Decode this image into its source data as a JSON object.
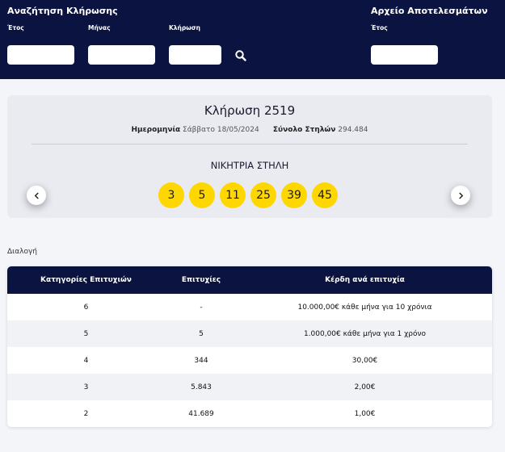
{
  "search": {
    "heading": "Αναζήτηση Κλήρωσης",
    "year_label": "Έτος",
    "month_label": "Μήνας",
    "draw_label": "Κλήρωση"
  },
  "archive": {
    "heading": "Αρχείο Αποτελεσμάτων",
    "year_label": "Έτος"
  },
  "draw": {
    "title": "Κλήρωση 2519",
    "date_label": "Ημερομηνία",
    "date_value": "Σάββατο 18/05/2024",
    "columns_label": "Σύνολο Στηλών",
    "columns_value": "294.484",
    "winning_label": "ΝΙΚΗΤΡΙΑ ΣΤΗΛΗ",
    "numbers": [
      "3",
      "5",
      "11",
      "25",
      "39",
      "45"
    ]
  },
  "section_label": "Διαλογή",
  "table": {
    "headers": [
      "Κατηγορίες Επιτυχιών",
      "Επιτυχίες",
      "Κέρδη ανά επιτυχία"
    ],
    "rows": [
      [
        "6",
        "-",
        "10.000,00€ κάθε μήνα για 10 χρόνια"
      ],
      [
        "5",
        "5",
        "1.000,00€ κάθε μήνα για 1 χρόνο"
      ],
      [
        "4",
        "344",
        "30,00€"
      ],
      [
        "3",
        "5.843",
        "2,00€"
      ],
      [
        "2",
        "41.689",
        "1,00€"
      ]
    ]
  },
  "colors": {
    "navy": "#0b1440",
    "ball": "#ffd700",
    "card": "#e9ebf1"
  }
}
